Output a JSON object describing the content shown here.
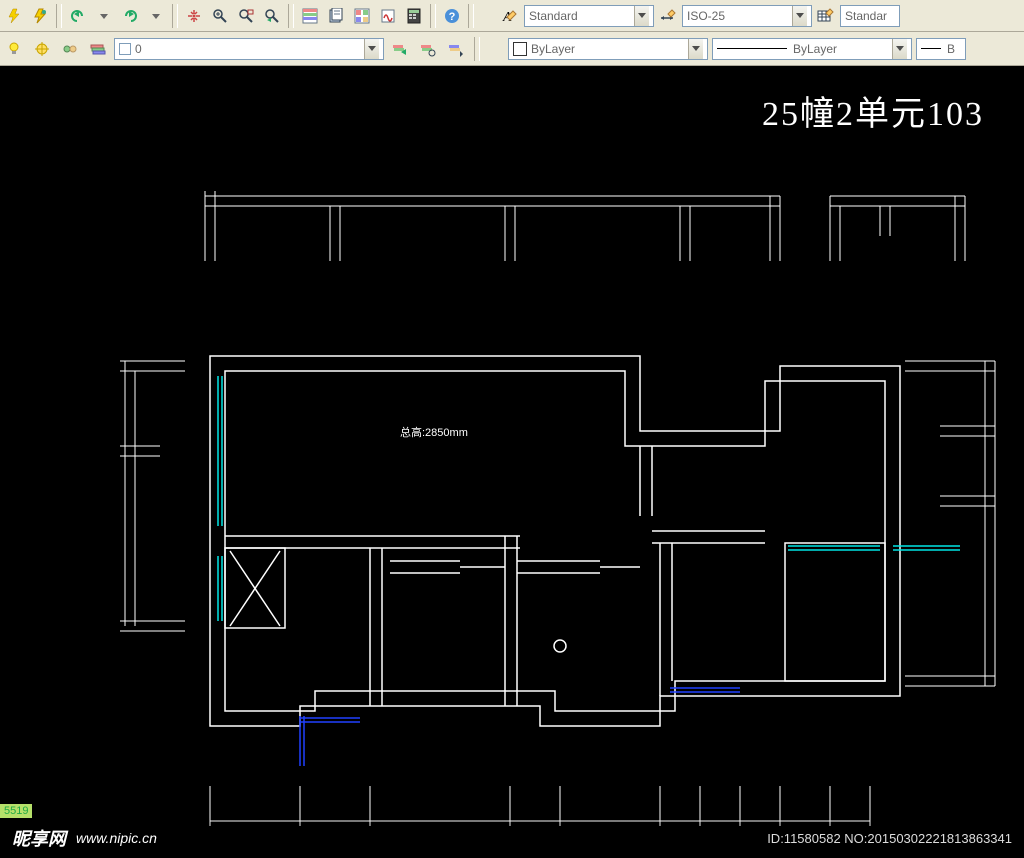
{
  "toolbar1": {
    "text_style_label": "Standard",
    "dim_style_label": "ISO-25",
    "table_style_label": "Standar"
  },
  "toolbar2": {
    "layer0_label": "0",
    "color_label": "ByLayer",
    "linetype_label": "ByLayer",
    "lineweight_label": "B"
  },
  "drawing": {
    "title": "25幢2单元103",
    "center_label": "总高:2850mm"
  },
  "footer": {
    "tag": "5519",
    "logo_text": "昵享网",
    "url": "www.nipic.cn",
    "meta": "ID:11580582 NO:20150302221813863341"
  }
}
